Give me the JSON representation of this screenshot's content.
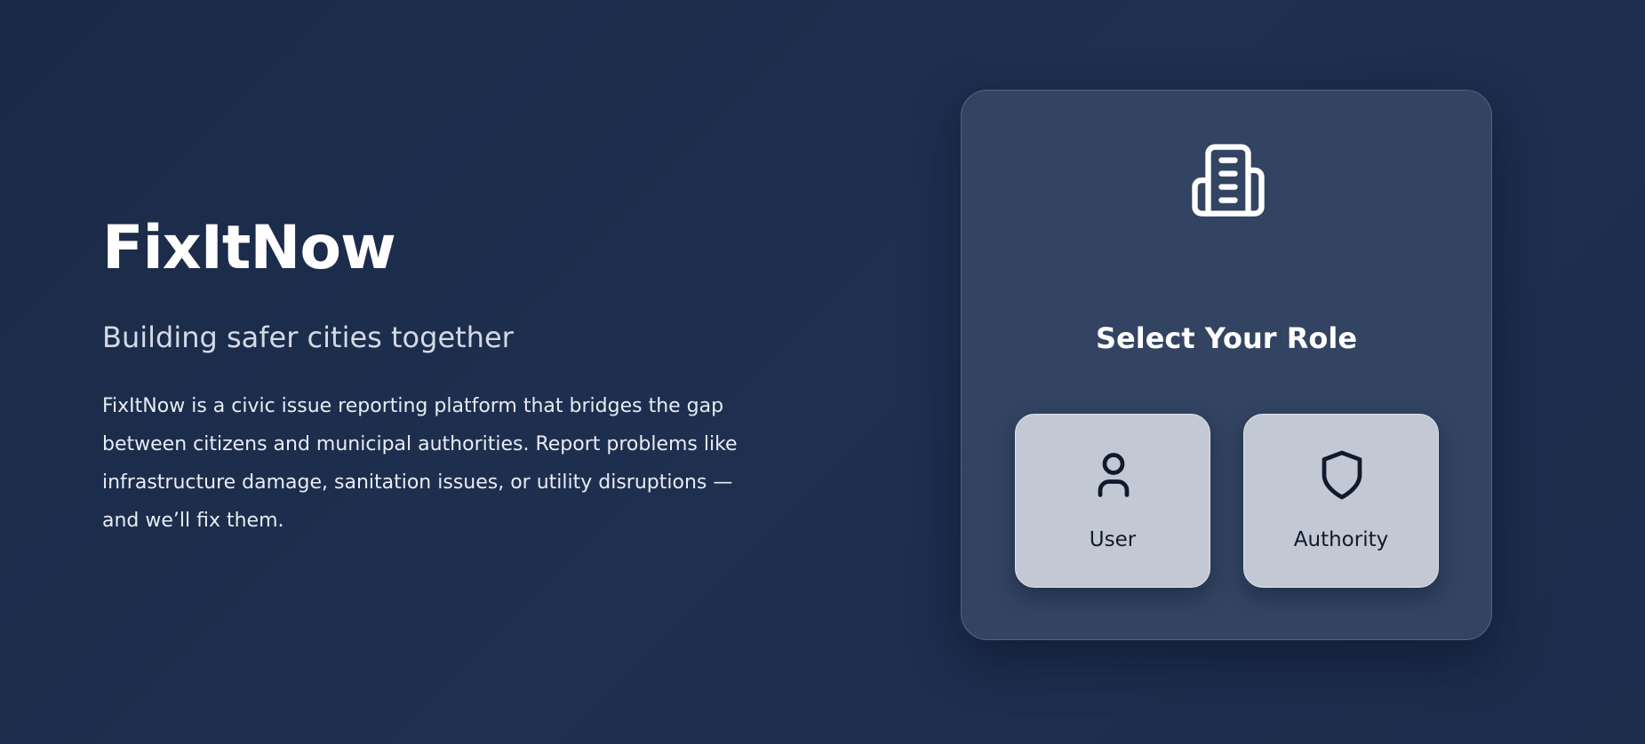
{
  "app": {
    "title": "FixItNow",
    "tagline": "Building safer cities together",
    "description": "FixItNow is a civic issue reporting platform that bridges the gap between citizens and municipal authorities. Report problems like infrastructure damage, sanitation issues, or utility disruptions — and we’ll fix them."
  },
  "role_card": {
    "icon": "building-icon",
    "title": "Select Your Role",
    "roles": [
      {
        "icon": "user-icon",
        "label": "User"
      },
      {
        "icon": "shield-icon",
        "label": "Authority"
      }
    ]
  },
  "colors": {
    "background": "#1e2f50",
    "card": "#324462",
    "role_button": "#c3c9d4",
    "text_primary": "#ffffff",
    "text_dark": "#111a2c"
  }
}
